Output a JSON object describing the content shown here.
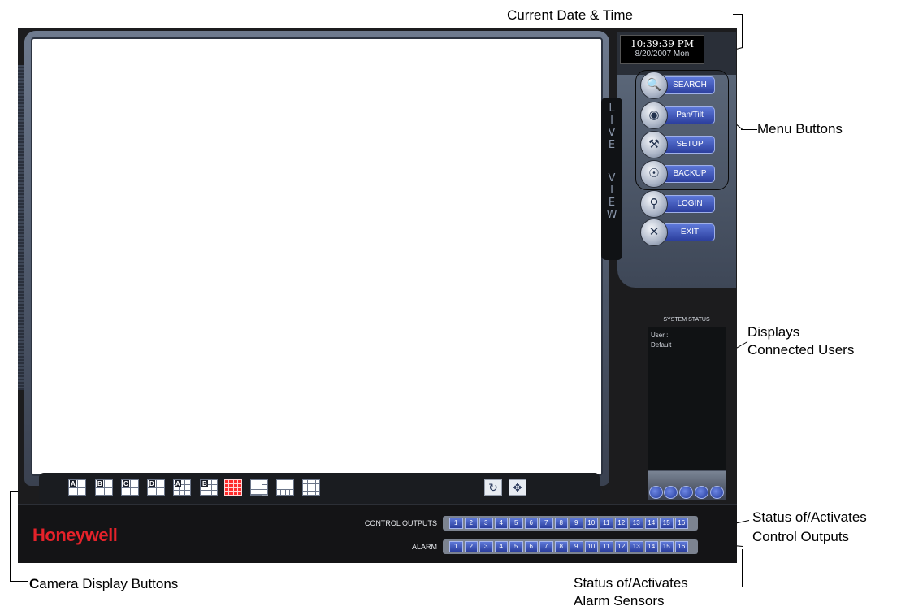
{
  "callouts": {
    "date_time": "Current Date & Time",
    "menu_buttons": "Menu Buttons",
    "users_line1": "Displays",
    "users_line2": "Connected Users",
    "control_line1": "Status of/Activates",
    "control_line2": "Control Outputs",
    "alarm_line1": "Status of/Activates",
    "alarm_line2": "Alarm Sensors",
    "camera_first": "C",
    "camera_rest": "amera Display Buttons"
  },
  "clock": {
    "time": "10:39:39 PM",
    "date": "8/20/2007 Mon"
  },
  "side_label": {
    "live": [
      "L",
      "I",
      "V",
      "E"
    ],
    "view": [
      "V",
      "I",
      "E",
      "W"
    ]
  },
  "menu": {
    "search": "SEARCH",
    "pantilt": "Pan/Tilt",
    "setup": "SETUP",
    "backup": "BACKUP",
    "login": "LOGIN",
    "exit": "EXIT"
  },
  "system_status": {
    "title": "SYSTEM STATUS",
    "user_label": "User :",
    "user_value": "Default"
  },
  "camera_buttons": {
    "tags": [
      "A",
      "B",
      "C",
      "D",
      "A",
      "B"
    ],
    "selected_index": 6
  },
  "bottom": {
    "brand": "Honeywell",
    "control_label": "CONTROL OUTPUTS",
    "alarm_label": "ALARM",
    "numbers": [
      "1",
      "2",
      "3",
      "4",
      "5",
      "6",
      "7",
      "8",
      "9",
      "10",
      "11",
      "12",
      "13",
      "14",
      "15",
      "16"
    ]
  },
  "colors": {
    "brand_red": "#e5222a",
    "button_blue": "#2c3f9e",
    "selected_layout": "#ff2a2a"
  }
}
